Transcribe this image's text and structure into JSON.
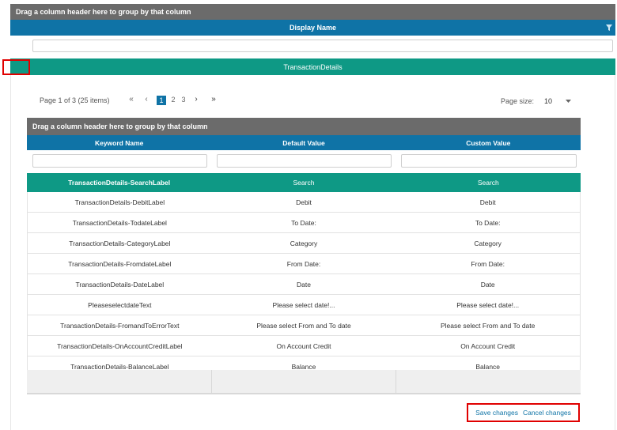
{
  "outer": {
    "group_panel_text": "Drag a column header here to group by that column",
    "column_header": "Display Name",
    "group_row_label": "TransactionDetails"
  },
  "pager": {
    "info": "Page 1 of 3 (25 items)",
    "first_icon": "«",
    "prev_icon": "‹",
    "pages": [
      "1",
      "2",
      "3"
    ],
    "current_page": "1",
    "next_icon": "›",
    "last_icon": "»",
    "page_size_label": "Page size:",
    "page_size_value": "10"
  },
  "inner": {
    "group_panel_text": "Drag a column header here to group by that column",
    "columns": [
      "Keyword Name",
      "Default Value",
      "Custom Value"
    ],
    "selected_row": [
      "TransactionDetails-SearchLabel",
      "Search",
      "Search"
    ],
    "rows": [
      [
        "TransactionDetails-DebitLabel",
        "Debit",
        "Debit"
      ],
      [
        "TransactionDetails-TodateLabel",
        "To Date:",
        "To Date:"
      ],
      [
        "TransactionDetails-CategoryLabel",
        "Category",
        "Category"
      ],
      [
        "TransactionDetails-FromdateLabel",
        "From Date:",
        "From Date:"
      ],
      [
        "TransactionDetails-DateLabel",
        "Date",
        "Date"
      ],
      [
        "PleaseselectdateText",
        "Please select date!...",
        "Please select date!..."
      ],
      [
        "TransactionDetails-FromandToErrorText",
        "Please select From and To date",
        "Please select From and To date"
      ],
      [
        "TransactionDetails-OnAccountCreditLabel",
        "On Account Credit",
        "On Account Credit"
      ],
      [
        "TransactionDetails-BalanceLabel",
        "Balance",
        "Balance"
      ]
    ]
  },
  "actions": {
    "save": "Save changes",
    "cancel": "Cancel changes"
  },
  "colors": {
    "header_blue": "#0f73a6",
    "group_teal": "#0e9985",
    "group_panel_gray": "#6b6b6b",
    "highlight_red": "#e00000"
  },
  "icons": {
    "filter": "filter-icon",
    "dropdown": "chevron-down-icon"
  }
}
